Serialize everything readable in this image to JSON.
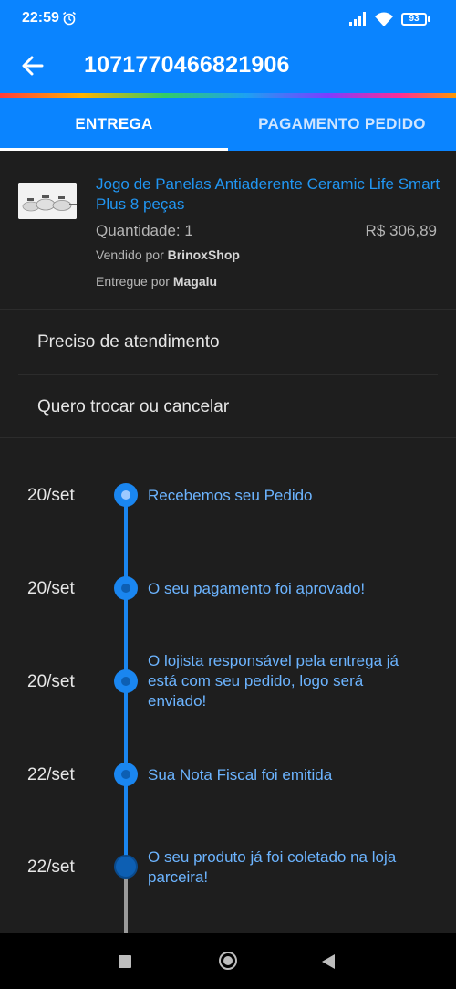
{
  "status_bar": {
    "time": "22:59",
    "battery": "93",
    "icons": [
      "alarm-icon",
      "signal-icon",
      "wifi-icon",
      "battery-icon"
    ]
  },
  "app_bar": {
    "back_icon": "arrow-left-icon",
    "title": "1071770466821906"
  },
  "tabs": [
    {
      "label": "ENTREGA",
      "active": true
    },
    {
      "label": "PAGAMENTO PEDIDO",
      "active": false
    }
  ],
  "product": {
    "name": "Jogo de Panelas Antiaderente Ceramic Life Smart Plus 8 peças",
    "quantity": "Quantidade: 1",
    "price": "R$ 306,89",
    "seller_prefix": "Vendido por",
    "seller": "BrinoxShop",
    "delivered_prefix": "Entregue por",
    "delivered_by": "Magalu"
  },
  "actions": [
    {
      "label": "Preciso de atendimento"
    },
    {
      "label": "Quero trocar ou cancelar"
    }
  ],
  "timeline": [
    {
      "date": "20/set",
      "text": "Recebemos seu Pedido"
    },
    {
      "date": "20/set",
      "text": "O seu pagamento foi aprovado!"
    },
    {
      "date": "20/set",
      "text": "O lojista responsável pela entrega já está com seu pedido, logo será enviado!"
    },
    {
      "date": "22/set",
      "text": "Sua Nota Fiscal foi emitida"
    },
    {
      "date": "22/set",
      "text": "O seu produto já foi coletado na loja parceira!"
    }
  ],
  "colors": {
    "primary": "#0a84ff",
    "background": "#1e1e1e",
    "timeline": "#1a86f0",
    "link": "#2196f3"
  },
  "nav_bar": {
    "icons": [
      "recents-square-icon",
      "home-circle-icon",
      "back-triangle-icon"
    ]
  }
}
